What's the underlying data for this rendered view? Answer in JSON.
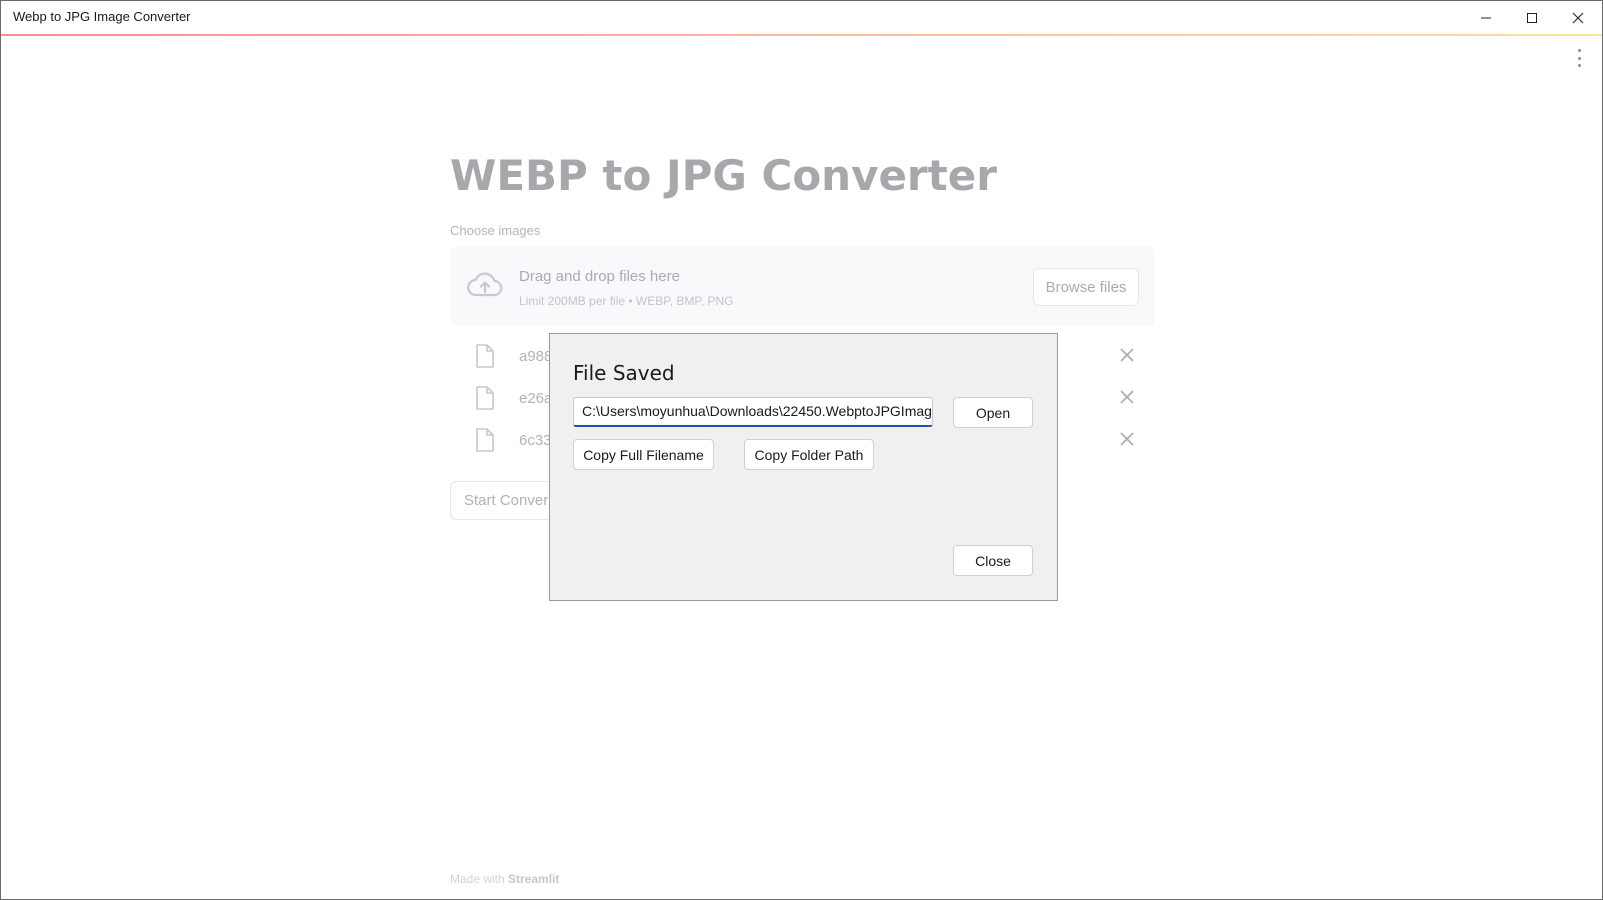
{
  "window": {
    "title": "Webp to JPG Image Converter",
    "minimize_glyph": "—",
    "maximize_glyph": "☐",
    "close_glyph": "✕"
  },
  "page": {
    "title": "WEBP to JPG Converter",
    "uploader": {
      "label": "Choose images",
      "drop_title": "Drag and drop files here",
      "drop_subtitle": "Limit 200MB per file • WEBP, BMP, PNG",
      "browse_label": "Browse files"
    },
    "files": [
      {
        "name": "a988"
      },
      {
        "name": "e26a"
      },
      {
        "name": "6c33"
      }
    ],
    "start_label": "Start Convers",
    "footer": {
      "prefix": "Made with ",
      "brand": "Streamlit"
    }
  },
  "dialog": {
    "title": "File Saved",
    "path_value": "C:\\Users\\moyunhua\\Downloads\\22450.WebptoJPGImag",
    "open_label": "Open",
    "copy_filename_label": "Copy Full Filename",
    "copy_folder_label": "Copy Folder Path",
    "close_label": "Close"
  },
  "colors": {
    "accent_start": "#ff8a8a",
    "accent_end": "#ffe0a0",
    "input_focus": "#1a56b0"
  }
}
